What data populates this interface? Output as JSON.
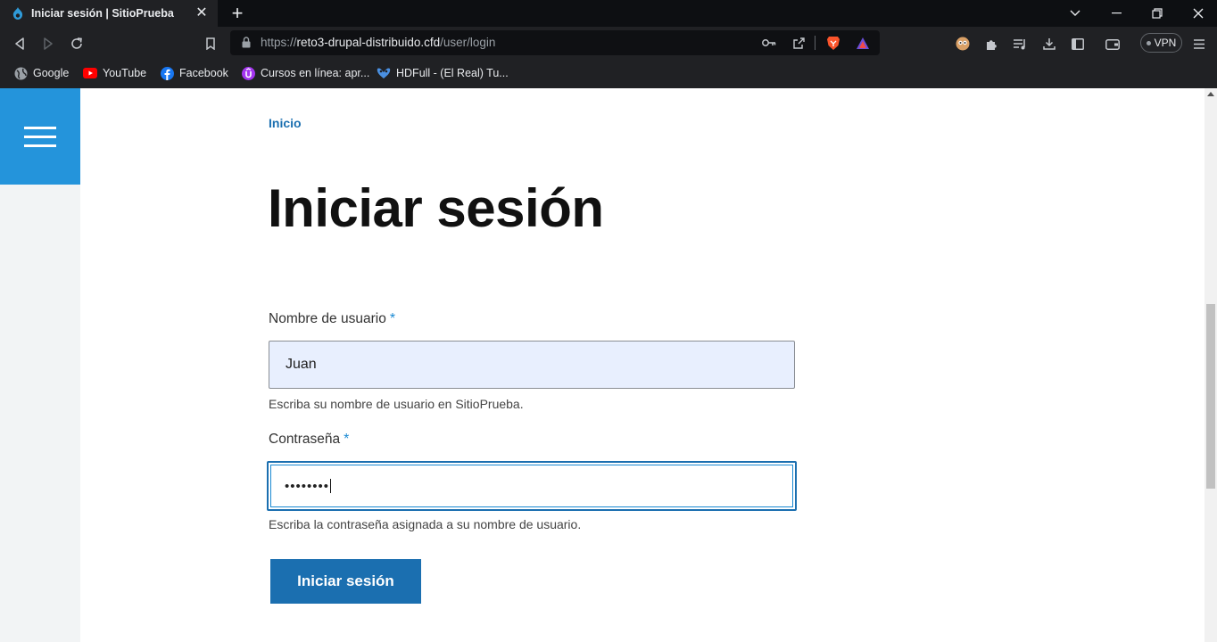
{
  "browser": {
    "tab": {
      "title": "Iniciar sesión | SitioPrueba"
    },
    "new_tab_label": "+",
    "url": {
      "scheme": "https://",
      "host": "reto3-drupal-distribuido.cfd",
      "path": "/user/login"
    },
    "vpn_label": "VPN",
    "bookmarks": [
      {
        "label": "Google",
        "icon": "globe-icon",
        "color": "#9aa0a6"
      },
      {
        "label": "YouTube",
        "icon": "youtube-icon",
        "color": "#ff0000"
      },
      {
        "label": "Facebook",
        "icon": "facebook-icon",
        "color": "#1877f2"
      },
      {
        "label": "Cursos en línea: apr...",
        "icon": "udemy-icon",
        "color": "#a435f0"
      },
      {
        "label": "HDFull - (El Real) Tu...",
        "icon": "hdfull-icon",
        "color": "#4a90e2"
      }
    ]
  },
  "page": {
    "breadcrumb": "Inicio",
    "title": "Iniciar sesión",
    "username": {
      "label": "Nombre de usuario",
      "required_mark": "*",
      "value": "Juan",
      "help": "Escriba su nombre de usuario en SitioPrueba."
    },
    "password": {
      "label": "Contraseña",
      "required_mark": "*",
      "value": "••••••••",
      "help": "Escriba la contraseña asignada a su nombre de usuario."
    },
    "submit_label": "Iniciar sesión",
    "accent_color": "#1b6fb0",
    "menu_color": "#2494db"
  }
}
